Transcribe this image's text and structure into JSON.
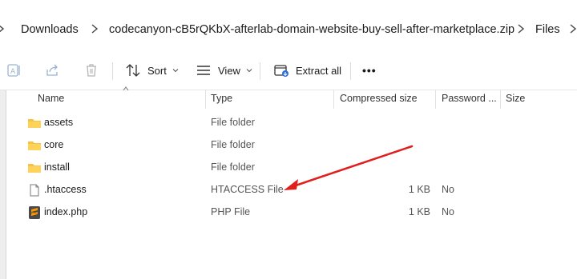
{
  "breadcrumb": {
    "items": [
      "Downloads",
      "codecanyon-cB5rQKbX-afterlab-domain-website-buy-sell-after-marketplace.zip",
      "Files"
    ]
  },
  "toolbar": {
    "sort_label": "Sort",
    "view_label": "View",
    "extract_label": "Extract all",
    "more_label": "•••"
  },
  "columns": {
    "name": "Name",
    "type": "Type",
    "compressed_size": "Compressed size",
    "password": "Password ...",
    "size": "Size"
  },
  "files": [
    {
      "name": "assets",
      "type": "File folder",
      "compressed_size": "",
      "password": "",
      "icon": "folder-icon"
    },
    {
      "name": "core",
      "type": "File folder",
      "compressed_size": "",
      "password": "",
      "icon": "folder-icon"
    },
    {
      "name": "install",
      "type": "File folder",
      "compressed_size": "",
      "password": "",
      "icon": "folder-icon"
    },
    {
      "name": ".htaccess",
      "type": "HTACCESS File",
      "compressed_size": "1 KB",
      "password": "No",
      "icon": "document-icon"
    },
    {
      "name": "index.php",
      "type": "PHP File",
      "compressed_size": "1 KB",
      "password": "No",
      "icon": "sublime-file-icon"
    }
  ],
  "colors": {
    "folder": "#f6c343",
    "annotation_arrow": "#e0201c"
  }
}
